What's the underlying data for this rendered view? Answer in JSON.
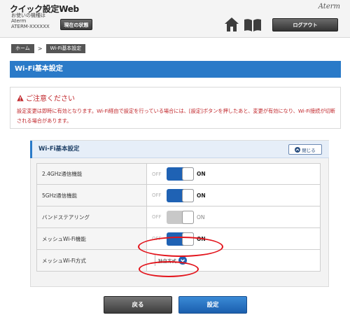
{
  "header": {
    "app_title": "クイック設定Web",
    "device_label": "お使いの機種は",
    "device_name": "Aterm",
    "device_id": "ATERM-XXXXXX",
    "status_button": "現在の状態",
    "brand": "Aterm",
    "home_icon": "home-icon",
    "manual_icon": "book-icon",
    "logout_button": "ログアウト"
  },
  "breadcrumb": {
    "home": "ホーム",
    "separator": ">",
    "current": "Wi-Fi基本設定"
  },
  "page_title": "Wi-Fi基本設定",
  "caution": {
    "title": "ご注意ください",
    "text": "設定変更は即時に有効となります。Wi-Fi経由で設定を行っている場合には、[設定]ボタンを押したあと、変更が有効になり、Wi-Fi接続が切断される場合があります。"
  },
  "section": {
    "title": "Wi-Fi基本設定",
    "close_button": "閉じる",
    "close_icon": "chevron-up-icon"
  },
  "settings": [
    {
      "label": "2.4GHz通信機能",
      "off": "OFF",
      "on": "ON",
      "state": "on",
      "enabled": true
    },
    {
      "label": "5GHz通信機能",
      "off": "OFF",
      "on": "ON",
      "state": "on",
      "enabled": true
    },
    {
      "label": "バンドステアリング",
      "off": "OFF",
      "on": "ON",
      "state": "on",
      "enabled": false
    },
    {
      "label": "メッシュWi-Fi機能",
      "off": "OFF",
      "on": "ON",
      "state": "on",
      "enabled": true
    },
    {
      "label": "メッシュWi-Fi方式",
      "selected": "独自方式",
      "select_icon": "chevron-down-icon"
    }
  ],
  "footer": {
    "back_button": "戻る",
    "apply_button": "設定"
  },
  "colors": {
    "accent": "#2a7ac8",
    "toggle_on": "#1f62b4",
    "warning": "#c0252a",
    "highlight_mark": "#e3141c"
  }
}
